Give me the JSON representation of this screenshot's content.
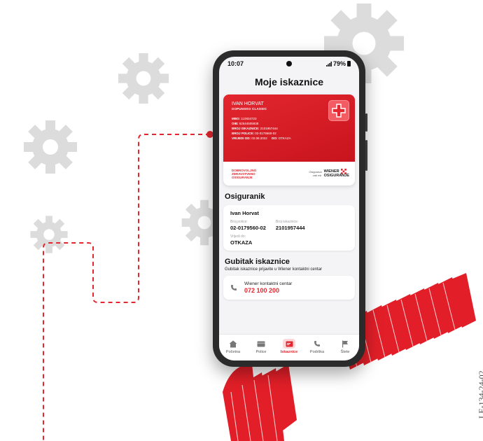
{
  "status_bar": {
    "time": "10:07",
    "battery": "79%"
  },
  "header": {
    "title": "Moje iskaznice"
  },
  "card": {
    "holder_name": "IVAN HORVAT",
    "plan": "DOPUNSKO CLASSIC",
    "rows": [
      {
        "label": "MBO:",
        "value": "110834723"
      },
      {
        "label": "OIB:",
        "value": "62544505938"
      },
      {
        "label": "BROJ ISKAZNICE:",
        "value": "2101957444"
      },
      {
        "label": "BROJ POLICE:",
        "value": "02-0179560-02"
      }
    ],
    "valid_from_label": "VRIJEDI OD:",
    "valid_from_value": "02.08.2022",
    "valid_to_label": "DO:",
    "valid_to_value": "OTKAZA",
    "program_line1": "DOBROVOLJNO",
    "program_line2": "ZDRAVSTVENO",
    "program_line3": "OSIGURANJE",
    "tagline_line1": "Osiguravа",
    "tagline_line2": "vaš mir",
    "brand_line1": "WIENER",
    "brand_line2": "OSIGURANJE"
  },
  "insured": {
    "section_title": "Osiguranik",
    "name": "Ivan Horvat",
    "policy_label": "Broj police:",
    "policy_value": "02-0179560-02",
    "card_label": "Broj iskaznice:",
    "card_value": "2101957444",
    "valid_label": "Vrijedi do:",
    "valid_value": "OTKAZA"
  },
  "loss": {
    "section_title": "Gubitak iskaznice",
    "subtitle": "Gubitak iskaznice prijavite u Wiener kontaktni centar",
    "contact_label": "Wiener kontaktni centar",
    "contact_number": "072 100 200"
  },
  "nav": [
    {
      "label": "Početna",
      "icon": "home-icon"
    },
    {
      "label": "Police",
      "icon": "wallet-icon"
    },
    {
      "label": "Iskaznice",
      "icon": "card-icon",
      "active": true
    },
    {
      "label": "Podrška",
      "icon": "phone-icon"
    },
    {
      "label": "Štete",
      "icon": "flag-icon"
    }
  ],
  "doc_id": "LE-134-24-02",
  "colors": {
    "brand_red": "#e3262f",
    "gear_grey": "#d9d9d9",
    "nav_active_bg": "#fbd9da"
  }
}
